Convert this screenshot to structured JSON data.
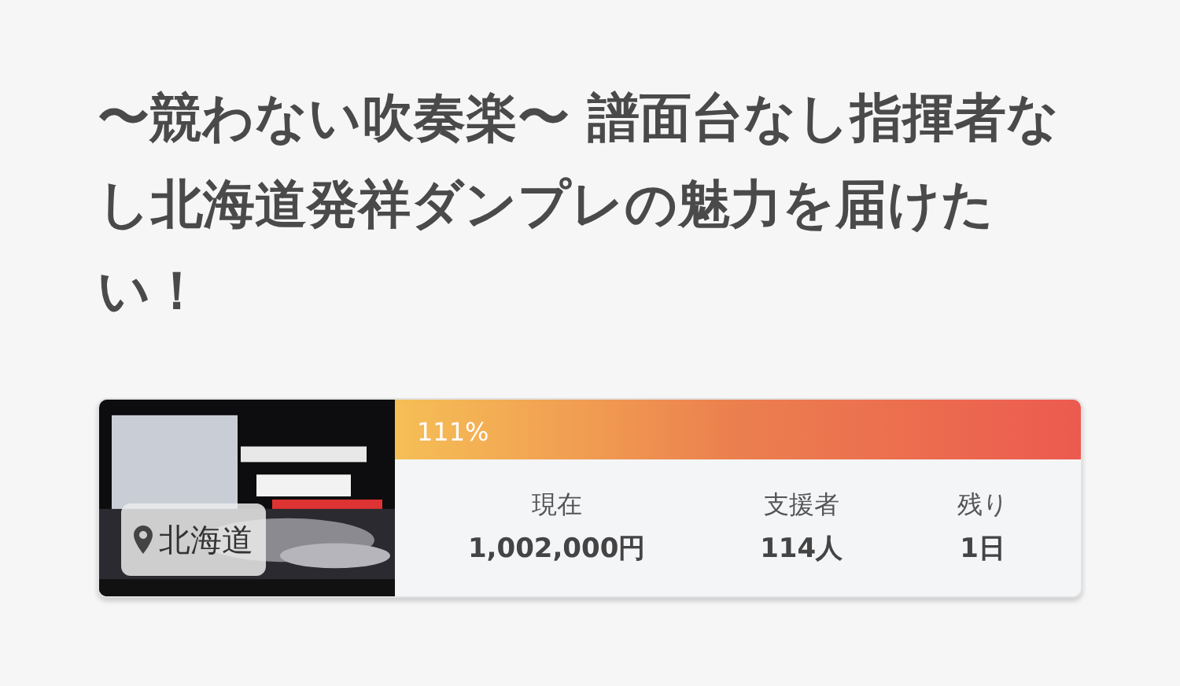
{
  "title": "〜競わない吹奏楽〜 譜面台なし指揮者なし北海道発祥ダンプレの魅力を届けたい！",
  "card": {
    "location": "北海道",
    "progress": {
      "reading": "111%",
      "level": 1
    },
    "stats": [
      {
        "label": "現在",
        "value": "1,002,000円"
      },
      {
        "label": "支援者",
        "value": "114人"
      },
      {
        "label": "残り",
        "value": "1日"
      }
    ]
  }
}
